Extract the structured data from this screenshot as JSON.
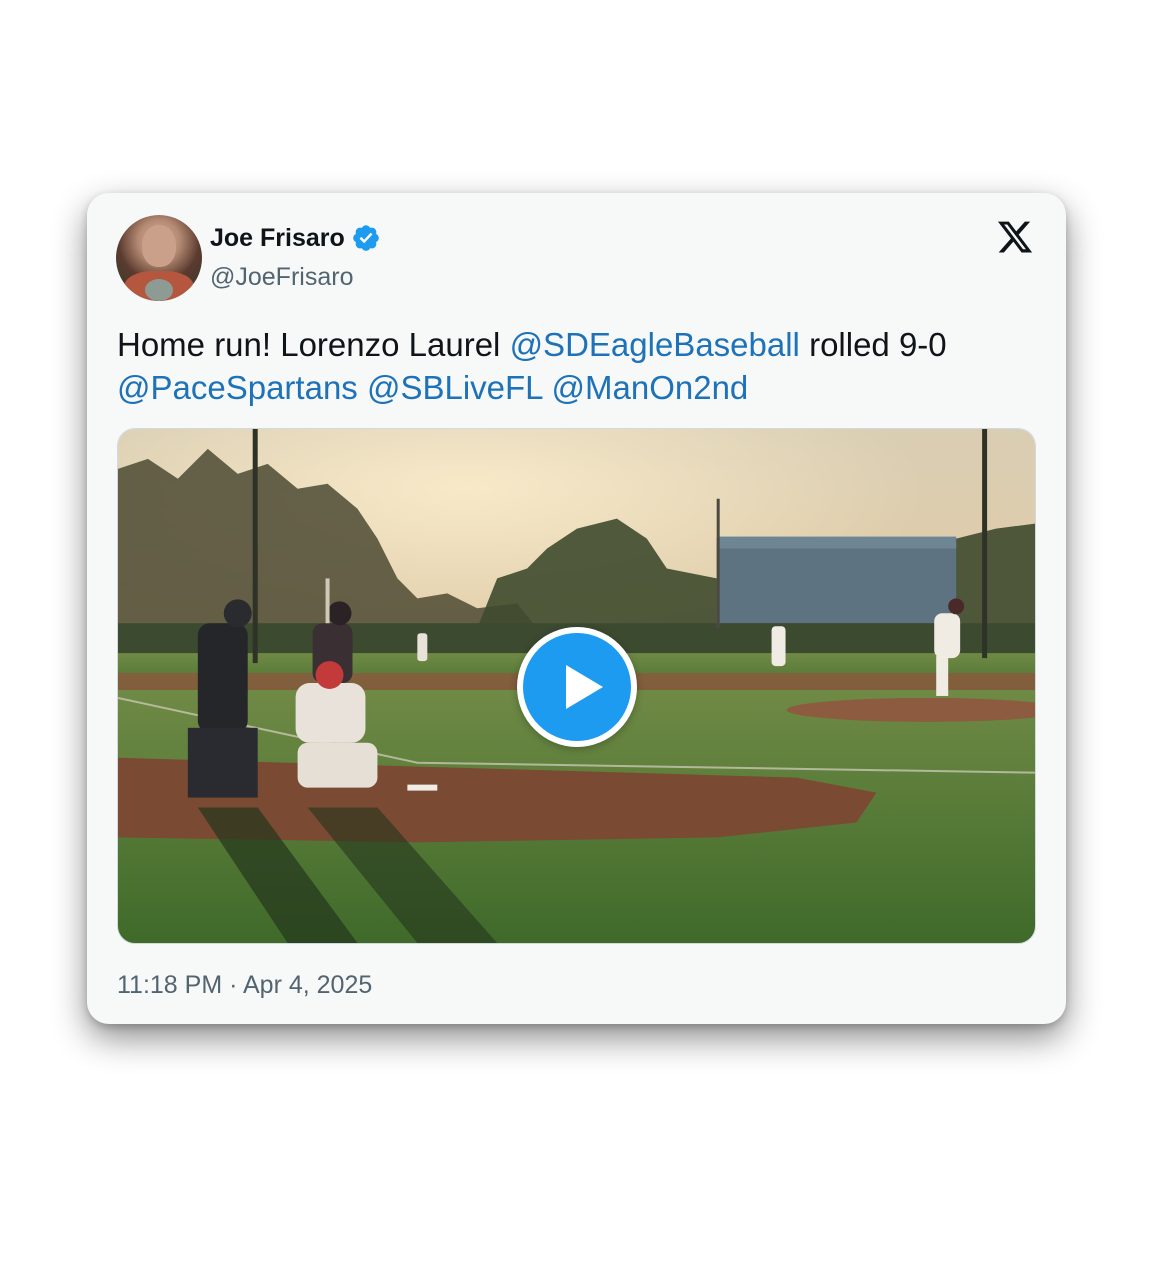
{
  "author": {
    "name": "Joe Frisaro",
    "handle": "@JoeFrisaro",
    "verified": true
  },
  "platform_icon": "x-logo-icon",
  "tweet": {
    "text_parts": [
      {
        "text": "Home run! Lorenzo Laurel ",
        "type": "plain"
      },
      {
        "text": "@SDEagleBaseball",
        "type": "mention"
      },
      {
        "text": " rolled 9-0",
        "type": "plain"
      },
      {
        "text": "@PaceSpartans",
        "type": "mention"
      },
      {
        "text": " ",
        "type": "plain"
      },
      {
        "text": "@SBLiveFL",
        "type": "mention"
      },
      {
        "text": " ",
        "type": "plain"
      },
      {
        "text": "@ManOn2nd",
        "type": "mention"
      }
    ]
  },
  "media": {
    "type": "video",
    "play_icon": "play-icon"
  },
  "timestamp": "11:18 PM · Apr 4, 2025",
  "colors": {
    "mention": "#1d72b8",
    "play_button": "#1d9bf0",
    "verified_badge": "#1d9bf0",
    "card_background": "#f7f9f9"
  }
}
